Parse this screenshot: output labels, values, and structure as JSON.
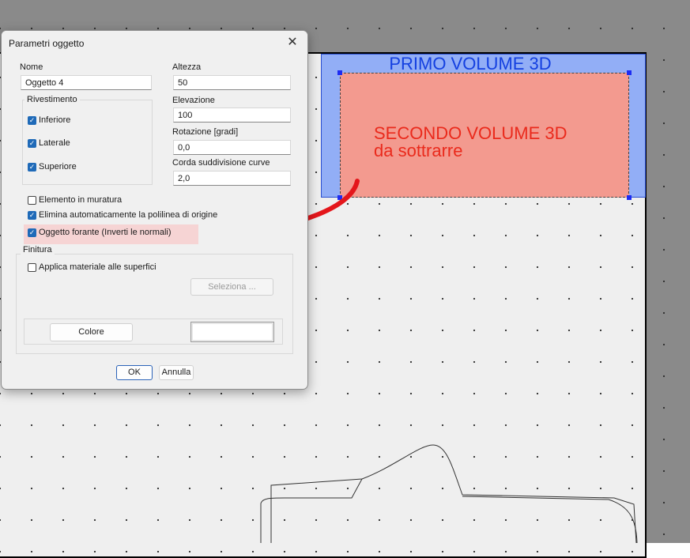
{
  "drawing": {
    "primo_volume_label": "PRIMO VOLUME 3D",
    "secondo_volume_label_1": "SECONDO VOLUME 3D",
    "secondo_volume_label_2": "da sottrarre",
    "colors": {
      "volume1_fill": "#92aef6",
      "volume2_fill": "#f39a8f",
      "annotation_red": "#e4161b",
      "handle_blue": "#1d2cf2"
    }
  },
  "dialog": {
    "title": "Parametri oggetto",
    "close_icon": "close-icon",
    "nome": {
      "label": "Nome",
      "value": "Oggetto 4"
    },
    "altezza": {
      "label": "Altezza",
      "value": "50"
    },
    "elevazione": {
      "label": "Elevazione",
      "value": "100"
    },
    "rotazione": {
      "label": "Rotazione  [gradi]",
      "value": "0,0"
    },
    "corda": {
      "label": "Corda suddivisione curve",
      "value": "2,0"
    },
    "rivestimento": {
      "title": "Rivestimento",
      "items": [
        {
          "label": "Inferiore",
          "checked": true
        },
        {
          "label": "Laterale",
          "checked": true
        },
        {
          "label": "Superiore",
          "checked": true
        }
      ]
    },
    "options": [
      {
        "label": "Elemento in muratura",
        "checked": false
      },
      {
        "label": "Elimina automaticamente la polilinea di origine",
        "checked": true
      },
      {
        "label": "Oggetto forante (Inverti le normali)",
        "checked": true
      }
    ],
    "finitura": {
      "title": "Finitura",
      "applica_label": "Applica materiale alle superfici",
      "applica_checked": false,
      "seleziona_label": "Seleziona ...",
      "colore_label": "Colore",
      "colore_value": "#ffffff"
    },
    "ok_label": "OK",
    "annulla_label": "Annulla"
  }
}
